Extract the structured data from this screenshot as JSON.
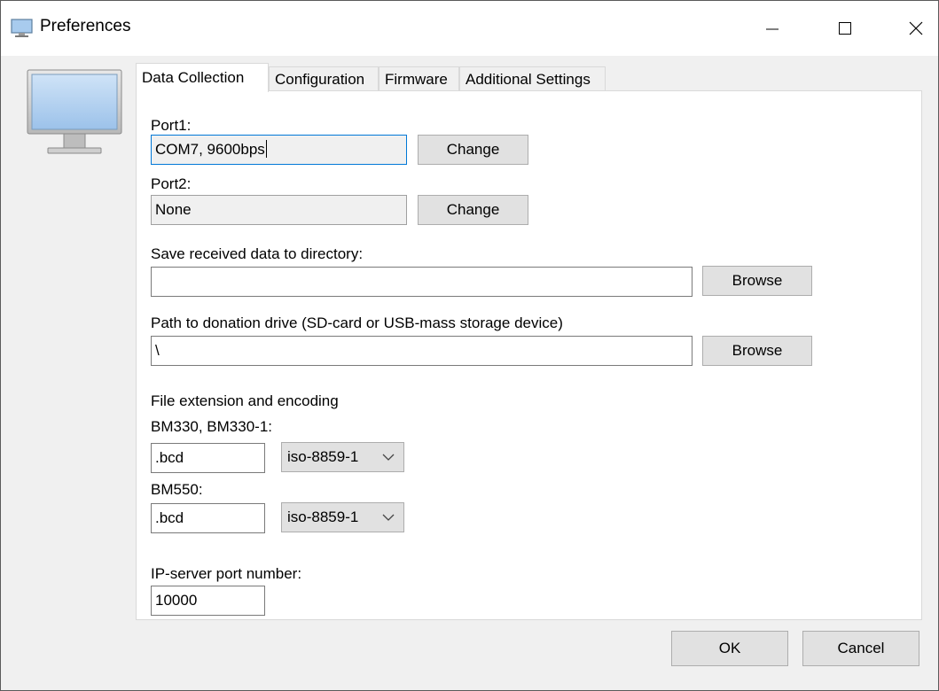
{
  "window": {
    "title": "Preferences"
  },
  "tabs": [
    "Data Collection",
    "Configuration",
    "Firmware",
    "Additional Settings"
  ],
  "port1": {
    "label": "Port1:",
    "value": "COM7, 9600bps",
    "button": "Change"
  },
  "port2": {
    "label": "Port2:",
    "value": "None",
    "button": "Change"
  },
  "save_dir": {
    "label": "Save received data to directory:",
    "value": "",
    "button": "Browse"
  },
  "donation": {
    "label": "Path to donation drive (SD-card or USB-mass storage device)",
    "value": "\\",
    "button": "Browse"
  },
  "encoding": {
    "title": "File extension and encoding",
    "bm330": {
      "label": "BM330, BM330-1:",
      "ext": ".bcd",
      "enc": "iso-8859-1"
    },
    "bm550": {
      "label": "BM550:",
      "ext": ".bcd",
      "enc": "iso-8859-1"
    }
  },
  "ip_server": {
    "label": "IP-server port number:",
    "value": "10000"
  },
  "footer": {
    "ok": "OK",
    "cancel": "Cancel"
  },
  "colors": {
    "accent": "#0078d7",
    "monitor_screen": "#a8cbee"
  },
  "icons": [
    "monitor-icon",
    "minimize-icon",
    "maximize-icon",
    "close-icon",
    "chevron-down-icon"
  ]
}
